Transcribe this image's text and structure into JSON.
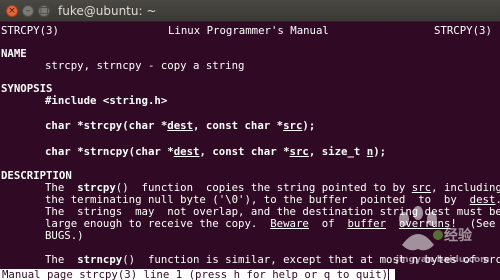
{
  "window": {
    "title": "fuke@ubuntu: ~",
    "controls": {
      "close": "×",
      "minimize": "–",
      "maximize": "□"
    }
  },
  "man": {
    "header_left": "STRCPY(3)",
    "header_center": "Linux Programmer's Manual",
    "header_right": "STRCPY(3)",
    "name_heading": "NAME",
    "name_text": "strcpy, strncpy - copy a string",
    "synopsis_heading": "SYNOPSIS",
    "include": "#include <string.h>",
    "proto1": {
      "a": "char *strcpy(char *",
      "dest": "dest",
      "b": ", const char *",
      "src": "src",
      "c": ");"
    },
    "proto2": {
      "a": "char *strncpy(char *",
      "dest": "dest",
      "b": ", const char *",
      "src": "src",
      "c": ", size_t ",
      "n": "n",
      "d": ");"
    },
    "description_heading": "DESCRIPTION",
    "desc1": {
      "a": "The  ",
      "strcpy": "strcpy",
      "b": "()  function  copies the string pointed to by ",
      "src": "src",
      "c": ", including"
    },
    "desc2": {
      "a": "the terminating null byte ('\\0'), to the buffer  pointed  to  by  ",
      "dest": "dest",
      "b": "."
    },
    "desc3": "The  strings  may  not overlap, and the destination string dest must be",
    "desc4": {
      "a": "large enough to receive the copy.  ",
      "beware": "Beware",
      "b": "  of  ",
      "buffer": "buffer",
      "c": "  ",
      "overruns": "overruns",
      "d": "!  (See"
    },
    "desc5": "BUGS.)",
    "desc6": {
      "a": "The  ",
      "strncpy": "strncpy",
      "b": "()  function is similar, except that at most n bytes of src"
    }
  },
  "statusbar": {
    "text": "Manual page strcpy(3) line 1 (press h for help or q to quit)"
  },
  "watermark": {
    "brand": "Bai度",
    "sub": "jingyan.baidu.com",
    "label": "经验"
  }
}
